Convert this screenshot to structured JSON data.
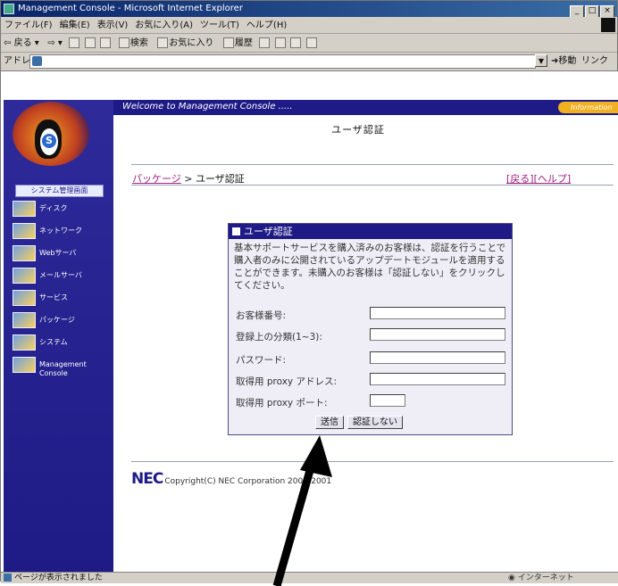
{
  "window": {
    "title": "Management Console - Microsoft Internet Explorer",
    "controls": [
      "_",
      "□",
      "×"
    ]
  },
  "menubar": {
    "items": [
      "ファイル(F)",
      "編集(E)",
      "表示(V)",
      "お気に入り(A)",
      "ツール(T)",
      "ヘルプ(H)"
    ]
  },
  "toolbar": {
    "back_label": "戻る",
    "search_label": "検索",
    "favorites_label": "お気に入り",
    "history_label": "履歴"
  },
  "addressbar": {
    "label": "アドレス(D)",
    "go_label": "移動",
    "links_label": "リンク"
  },
  "header": {
    "welcome": "Welcome to Management Console .....",
    "info_tab": "Information"
  },
  "sidebar": {
    "badge": "システム管理画面",
    "items": [
      {
        "label": "ディスク"
      },
      {
        "label": "ネットワーク"
      },
      {
        "label": "Webサーバ"
      },
      {
        "label": "メールサーバ"
      },
      {
        "label": "サービス"
      },
      {
        "label": "パッケージ"
      },
      {
        "label": "システム"
      },
      {
        "label": "Management Console"
      }
    ]
  },
  "main": {
    "title": "ユーザ認証",
    "breadcrumb": {
      "parent": "パッケージ",
      "separator": " > ",
      "current": "ユーザ認証"
    },
    "links": {
      "back": "[戻る]",
      "help": "[ヘルプ]"
    }
  },
  "auth_form": {
    "heading": "ユーザ認証",
    "description": "基本サポートサービスを購入済みのお客様は、認証を行うことで購入者のみに公開されているアップデートモジュールを適用することができます。未購入のお客様は「認証しない」をクリックしてください。",
    "fields": [
      {
        "label": "お客様番号:",
        "value": ""
      },
      {
        "label": "登録上の分類(1~3):",
        "value": ""
      },
      {
        "label": "パスワード:",
        "value": ""
      },
      {
        "label": "取得用 proxy アドレス:",
        "value": ""
      },
      {
        "label": "取得用 proxy ポート:",
        "value": ""
      }
    ],
    "submit_label": "送信",
    "skip_label": "認証しない"
  },
  "footer": {
    "brand": "NEC",
    "copyright": "Copyright(C) NEC Corporation 2000-2001"
  },
  "statusbar": {
    "text": "ページが表示されました",
    "zone": "インターネット"
  },
  "colors": {
    "brand_navy": "#1e1b86",
    "link_magenta": "#a02080",
    "info_orange": "#f0b020",
    "annotation_arrow": "#000000"
  }
}
